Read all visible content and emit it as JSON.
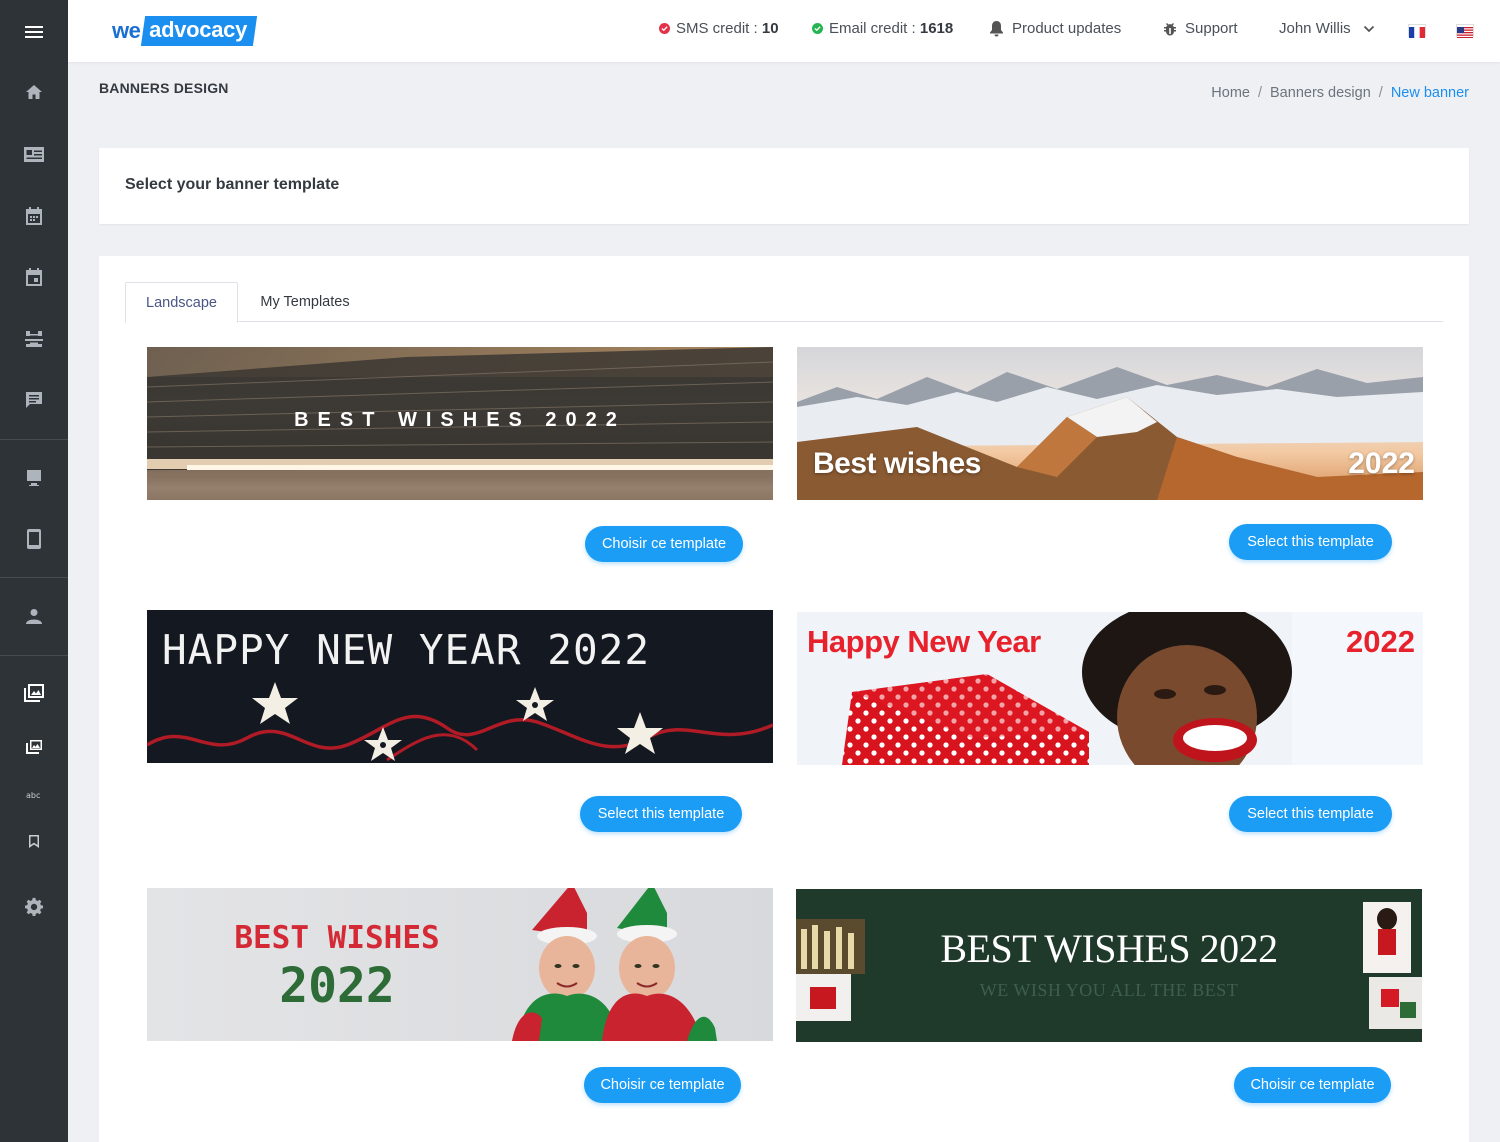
{
  "brand": {
    "logo_we": "we",
    "logo_name": "advocacy",
    "accent": "#1b9cf5"
  },
  "topbar": {
    "sms_label": "SMS credit :",
    "sms_value": "10",
    "email_label": "Email credit :",
    "email_value": "1618",
    "product_updates": "Product updates",
    "support": "Support",
    "user_name": "John Willis",
    "languages": [
      "fr-flag",
      "us-flag"
    ]
  },
  "page": {
    "title": "BANNERS DESIGN",
    "breadcrumb": {
      "home": "Home",
      "section": "Banners design",
      "current": "New banner",
      "separator": "/"
    }
  },
  "select_card": {
    "heading": "Select your banner template"
  },
  "tabs": [
    {
      "label": "Landscape",
      "active": true
    },
    {
      "label": "My Templates",
      "active": false
    }
  ],
  "templates": [
    {
      "text_main": "BEST WISHES 2022",
      "button": "Choisir ce template"
    },
    {
      "text_left": "Best wishes",
      "text_right": "2022",
      "button": "Select this template"
    },
    {
      "text_main": "HAPPY NEW YEAR 2022",
      "button": "Select this template"
    },
    {
      "text_left": "Happy New Year",
      "text_right": "2022",
      "button": "Select this template"
    },
    {
      "text_line1": "BEST WISHES",
      "text_line2": "2022",
      "button": "Choisir ce template"
    },
    {
      "text_main": "BEST WISHES 2022",
      "text_sub": "WE WISH YOU ALL THE BEST",
      "button": "Choisir ce template"
    }
  ],
  "sidebar": {
    "items": [
      "home-icon",
      "contact-card-icon",
      "calendar-icon",
      "event-icon",
      "share-icon",
      "chat-icon",
      "desktop-icon",
      "mobile-icon",
      "user-icon",
      "gallery-icon",
      "image-icon",
      "text-icon",
      "bookmark-icon",
      "settings-icon"
    ]
  }
}
